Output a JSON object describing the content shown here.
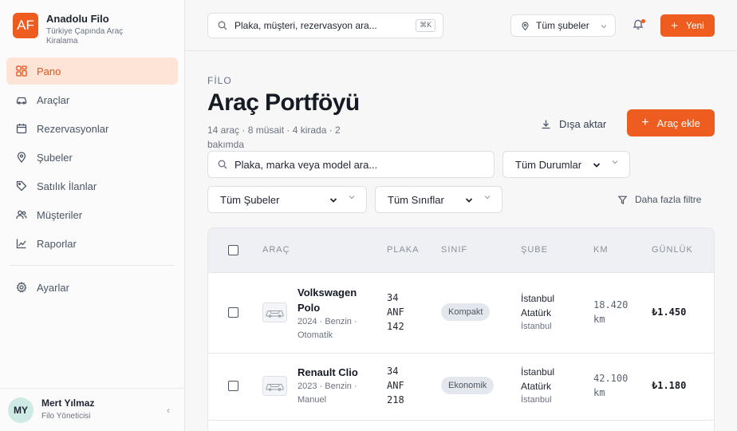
{
  "brand": {
    "initials": "AF",
    "name": "Anadolu Filo",
    "tagline": "Türkiye Çapında Araç Kiralama"
  },
  "sidebar": {
    "items": [
      {
        "label": "Pano",
        "icon": "grid-icon",
        "active": true
      },
      {
        "label": "Araçlar",
        "icon": "car-icon"
      },
      {
        "label": "Rezervasyonlar",
        "icon": "calendar-icon"
      },
      {
        "label": "Şubeler",
        "icon": "map-pin-icon"
      },
      {
        "label": "Satılık İlanlar",
        "icon": "tag-icon"
      },
      {
        "label": "Müşteriler",
        "icon": "users-icon"
      },
      {
        "label": "Raporlar",
        "icon": "chart-icon"
      }
    ],
    "settings": {
      "label": "Ayarlar",
      "icon": "gear-icon"
    }
  },
  "user": {
    "initials": "MY",
    "name": "Mert Yılmaz",
    "role": "Filo Yöneticisi"
  },
  "topbar": {
    "search_placeholder": "Plaka, müşteri, rezervasyon ara...",
    "shortcut": "⌘K",
    "branch": "Tüm şubeler",
    "new_label": "Yeni"
  },
  "page": {
    "eyebrow": "FİLO",
    "title": "Araç Portföyü",
    "subtitle": "14 araç · 8 müsait · 4 kirada · 2 bakımda",
    "export_label": "Dışa aktar",
    "add_label": "Araç ekle"
  },
  "filters": {
    "search_placeholder": "Plaka, marka veya model ara...",
    "status": "Tüm Durumlar",
    "branch": "Tüm Şubeler",
    "class": "Tüm Sınıflar",
    "more": "Daha fazla filtre"
  },
  "table": {
    "columns": [
      "ARAÇ",
      "PLAKA",
      "SINIF",
      "ŞUBE",
      "KM",
      "GÜNLÜK"
    ],
    "rows": [
      {
        "name_line1": "Volkswagen",
        "name_line2": "Polo",
        "meta_line1": "2024 · Benzin ·",
        "meta_line2": "Otomatik",
        "plate_line1": "34",
        "plate_line2": "ANF",
        "plate_line3": "142",
        "class": "Kompakt",
        "branch_line1": "İstanbul",
        "branch_line2": "Atatürk",
        "city": "İstanbul",
        "km_line1": "18.420",
        "km_line2": "km",
        "daily": "₺1.450"
      },
      {
        "name_line1": "Renault Clio",
        "name_line2": "",
        "meta_line1": "2023 · Benzin ·",
        "meta_line2": "Manuel",
        "plate_line1": "34",
        "plate_line2": "ANF",
        "plate_line3": "218",
        "class": "Ekonomik",
        "branch_line1": "İstanbul",
        "branch_line2": "Atatürk",
        "city": "İstanbul",
        "km_line1": "42.100",
        "km_line2": "km",
        "daily": "₺1.180"
      }
    ]
  },
  "colors": {
    "accent": "#ee5d1f",
    "active_bg": "#fde4d6",
    "avatar_bg": "#cfe9e4"
  }
}
